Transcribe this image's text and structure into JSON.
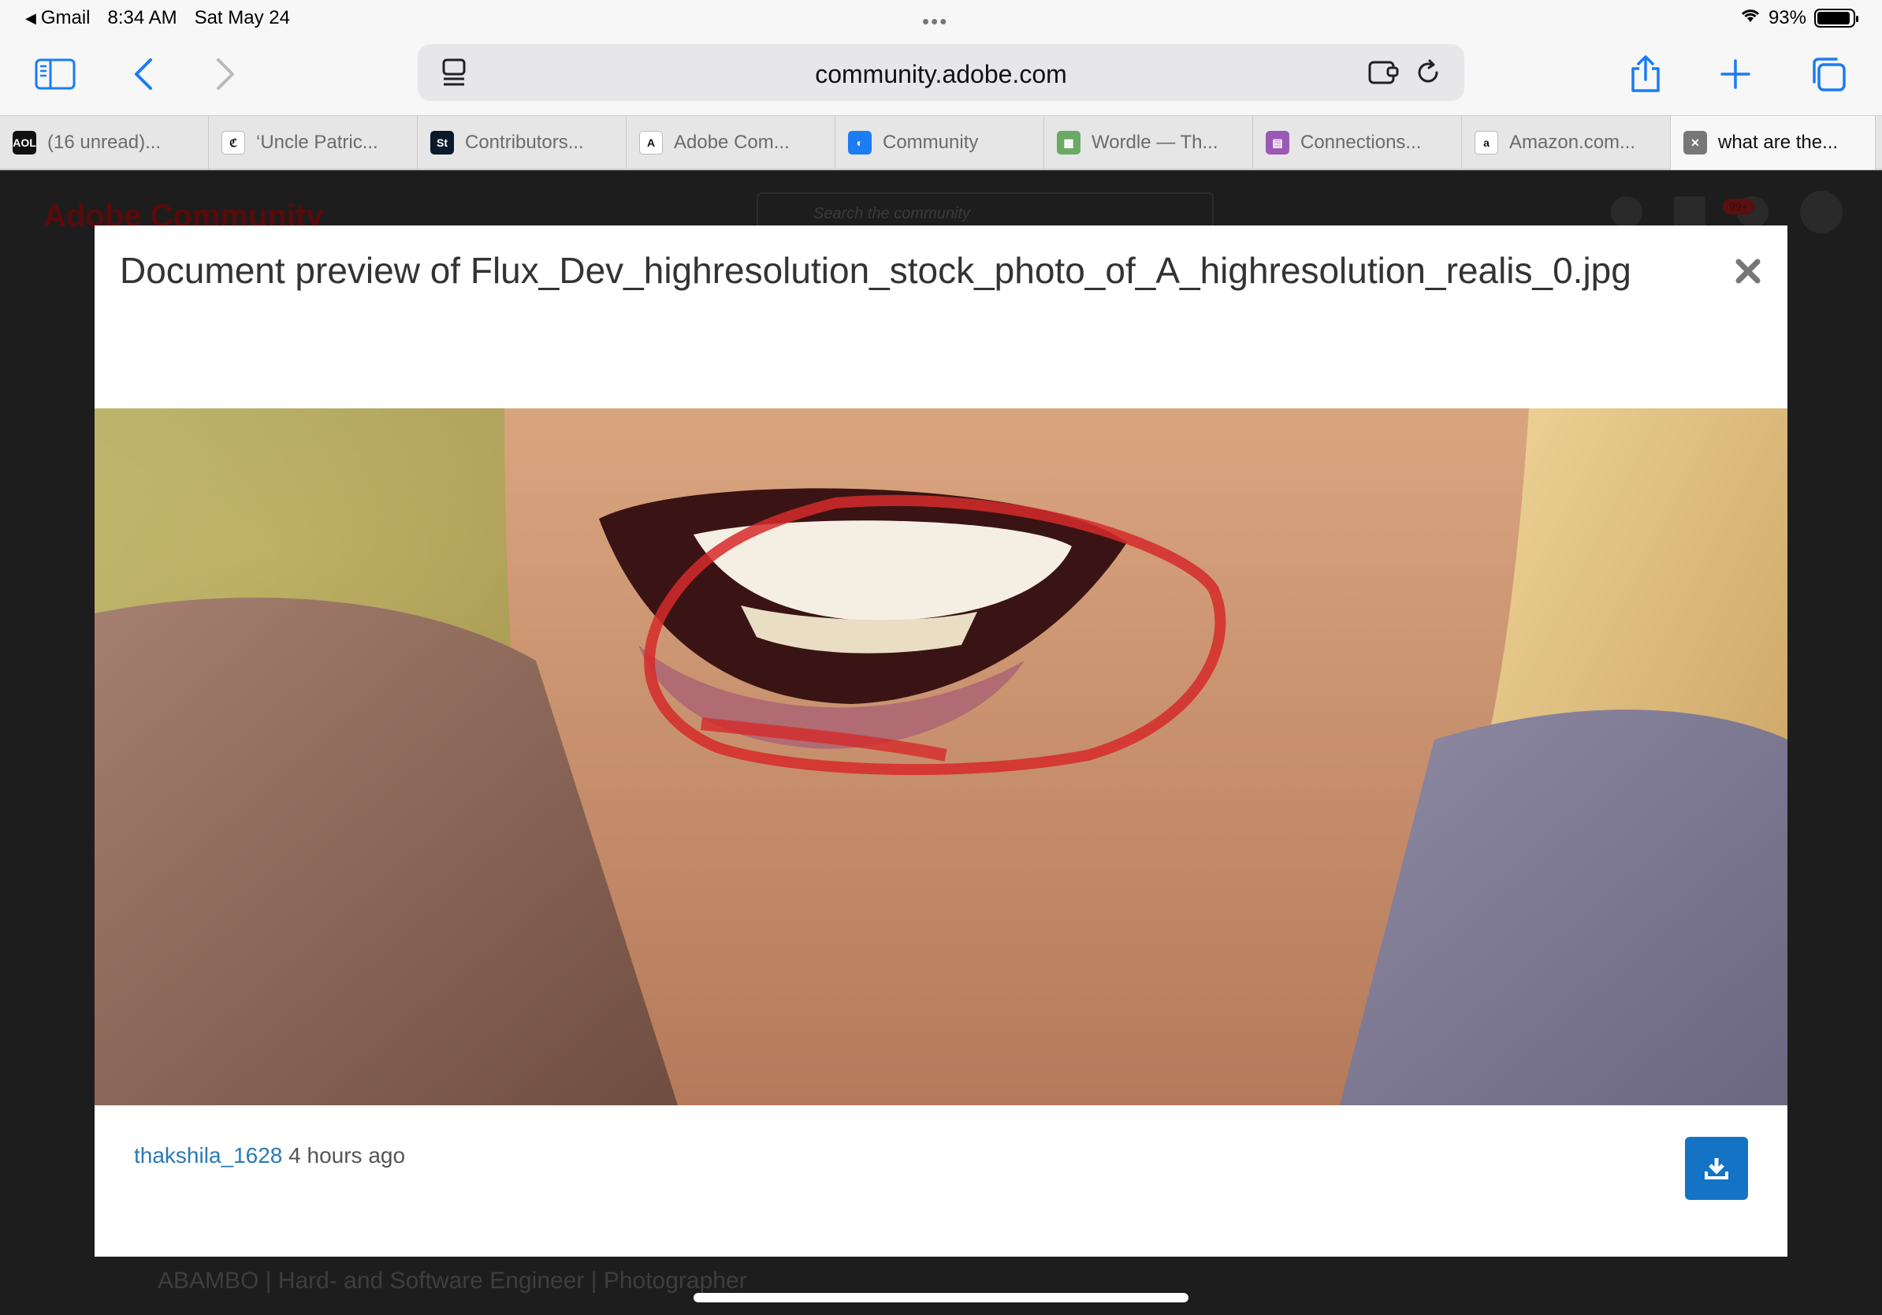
{
  "status": {
    "back_app": "Gmail",
    "time": "8:34 AM",
    "date": "Sat May 24",
    "battery": "93%",
    "battery_level": 0.93
  },
  "toolbar": {
    "url": "community.adobe.com",
    "icons": [
      "sidebar-icon",
      "back-icon",
      "forward-icon",
      "page-menu-icon",
      "extension-icon",
      "reload-icon",
      "share-icon",
      "plus-icon",
      "tabs-icon"
    ]
  },
  "tabs": [
    {
      "label": "(16 unread)...",
      "favicon": "AOL",
      "fav_color": "#111111"
    },
    {
      "label": "‘Uncle Patric...",
      "favicon": "ℭ",
      "fav_color": "#ffffff"
    },
    {
      "label": "Contributors...",
      "favicon": "St",
      "fav_color": "#0b1a2b"
    },
    {
      "label": "Adobe Com...",
      "favicon": "A",
      "fav_color": "#ffffff"
    },
    {
      "label": "Community",
      "favicon": "◐",
      "fav_color": "#1d7cf2"
    },
    {
      "label": "Wordle — Th...",
      "favicon": "▦",
      "fav_color": "#6aaa64"
    },
    {
      "label": "Connections...",
      "favicon": "▤",
      "fav_color": "#9b59b6"
    },
    {
      "label": "Amazon.com...",
      "favicon": "a",
      "fav_color": "#ffffff"
    },
    {
      "label": "what are the...",
      "favicon": "✕",
      "fav_color": "#777777"
    }
  ],
  "background_page": {
    "brand": "Adobe Community",
    "search_placeholder": "Search the community",
    "notification_badge": "99+",
    "footer_text": "ABAMBO | Hard- and Software Engineer | Photographer"
  },
  "modal": {
    "title": "Document preview of Flux_Dev_highresolution_stock_photo_of_A_highresolution_realis_0.jpg",
    "author": "thakshila_1628",
    "time_ago": "4 hours ago",
    "accent": "#1473c4"
  }
}
